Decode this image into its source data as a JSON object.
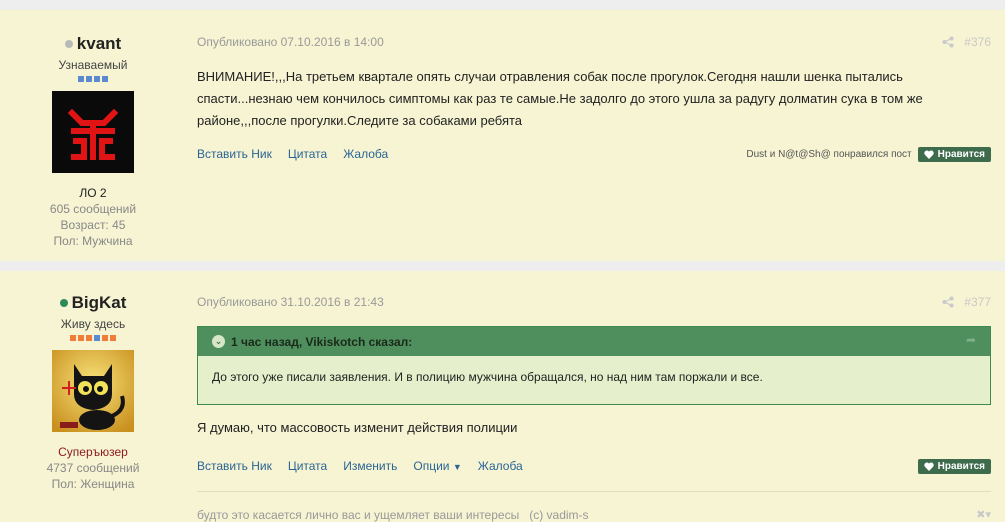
{
  "posts": [
    {
      "author": {
        "name": "kvant",
        "status_color": "#b9b9b9",
        "rank_title": "Узнаваемый",
        "pip_colors": [
          "#5b8ad1",
          "#5b8ad1",
          "#5b8ad1",
          "#5b8ad1"
        ],
        "avatar_icon": "red-rune-icon",
        "group": "ЛО 2",
        "posts_count": "605 сообщений",
        "age": "Возраст: 45",
        "gender": "Пол: Мужчина"
      },
      "published": "Опубликовано 07.10.2016 в 14:00",
      "post_number": "#376",
      "text": "ВНИМАНИЕ!,,,На третьем квартале опять случаи отравления собак после прогулок.Сегодня нашли шенка пытались спасти...незнаю чем кончилось симптомы как раз те самые.Не задолго до этого ушла за радугу долматин сука в том же районе,,,после прогулки.Следите за собаками ребята",
      "actions": [
        "Вставить Ник",
        "Цитата",
        "Жалоба"
      ],
      "likers": "Dust и N@t@Sh@ понравился пост",
      "like_label": "Нравится"
    },
    {
      "author": {
        "name": "BigKat",
        "status_color": "#2e8b57",
        "rank_title": "Живу здесь",
        "pip_colors": [
          "#f07e3a",
          "#f07e3a",
          "#f07e3a",
          "#5b8ad1",
          "#f07e3a",
          "#f07e3a"
        ],
        "avatar_icon": "black-cat-icon",
        "group": "Суперъюзер",
        "posts_count": "4737 сообщений",
        "gender": "Пол: Женщина"
      },
      "published": "Опубликовано 31.10.2016 в 21:43",
      "post_number": "#377",
      "quote": {
        "header": "1 час назад, Vikiskotch сказал:",
        "text": "До этого уже писали заявления. И в полицию мужчина обращался, но над ним там поржали и все."
      },
      "text": "Я думаю, что массовость изменит действия полиции",
      "actions": [
        "Вставить Ник",
        "Цитата",
        "Изменить",
        "Опции",
        "Жалоба"
      ],
      "like_label": "Нравится",
      "signature": "будто это касается лично вас и ущемляет ваши интересы   (с) vadim-s"
    }
  ],
  "colors": {
    "post_bg": "#f6f4d2",
    "link": "#2a6496",
    "like_button": "#3d6b4c",
    "quote_header": "#4f8f5d"
  }
}
